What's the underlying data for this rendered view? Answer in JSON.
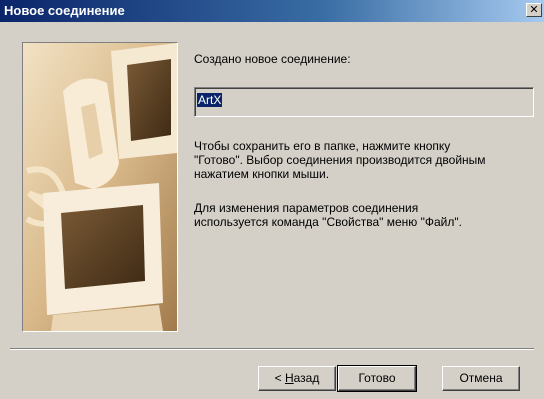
{
  "window": {
    "title": "Новое соединение",
    "close_glyph": "✕"
  },
  "content": {
    "created_label": "Создано новое соединение:",
    "connection_name": "ArtX",
    "save_hint_line1": "Чтобы сохранить его в папке, нажмите кнопку",
    "save_hint_line2": "\"Готово\".  Выбор соединения производится двойным",
    "save_hint_line3": "нажатием кнопки мыши.",
    "props_hint_line1": "Для изменения параметров соединения",
    "props_hint_line2": "используется команда \"Свойства\" меню \"Файл\"."
  },
  "buttons": {
    "back_arrow": "< ",
    "back_mnemonic": "Н",
    "back_rest": "азад",
    "finish": "Готово",
    "cancel": "Отмена"
  },
  "icons": {
    "illustration": "computers-and-phone-illustration",
    "close": "close-icon"
  },
  "colors": {
    "title_gradient_start": "#0a246a",
    "title_gradient_end": "#a6caf0",
    "face": "#d4d0c8",
    "selection": "#0a246a"
  }
}
